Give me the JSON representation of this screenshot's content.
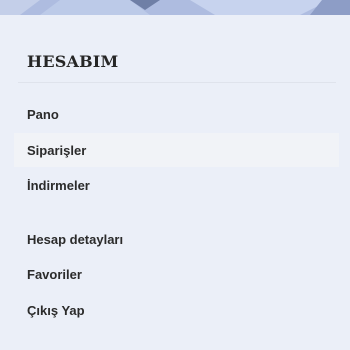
{
  "account_menu": {
    "title": "HESABIM",
    "active_item": "Siparişler",
    "items": [
      {
        "label": "Pano"
      },
      {
        "label": "Siparişler"
      },
      {
        "label": "İndirmeler"
      },
      {
        "label": "Hesap detayları"
      },
      {
        "label": "Favoriler"
      },
      {
        "label": "Çıkış Yap"
      }
    ]
  },
  "colors": {
    "background": "#ebeff8",
    "banner": "#aebce0",
    "active_row": "#f1f3f7",
    "text": "#2b2b2b"
  }
}
